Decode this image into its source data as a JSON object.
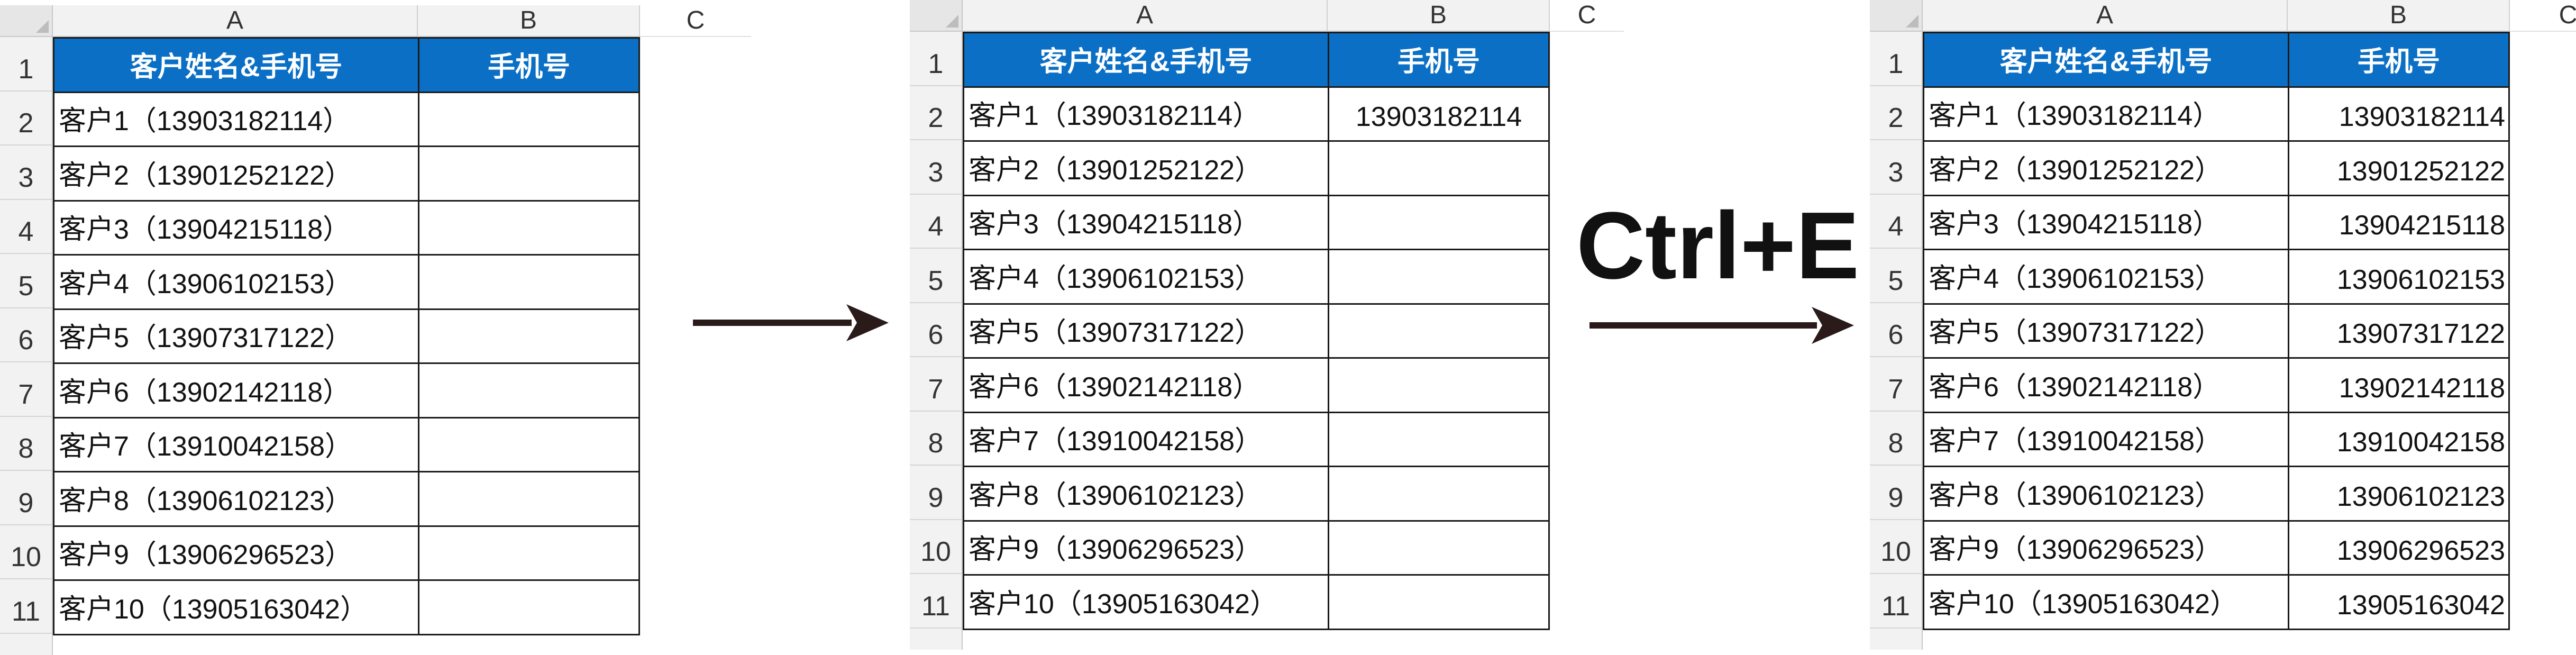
{
  "column_headers": [
    "A",
    "B",
    "C"
  ],
  "row_numbers": [
    "1",
    "2",
    "3",
    "4",
    "5",
    "6",
    "7",
    "8",
    "9",
    "10",
    "11"
  ],
  "header_row": {
    "col_a": "客户姓名&手机号",
    "col_b": "手机号"
  },
  "customers": [
    {
      "a": "客户1（13903182114）",
      "b": "13903182114"
    },
    {
      "a": "客户2（13901252122）",
      "b": "13901252122"
    },
    {
      "a": "客户3（13904215118）",
      "b": "13904215118"
    },
    {
      "a": "客户4（13906102153）",
      "b": "13906102153"
    },
    {
      "a": "客户5（13907317122）",
      "b": "13907317122"
    },
    {
      "a": "客户6（13902142118）",
      "b": "13902142118"
    },
    {
      "a": "客户7（13910042158）",
      "b": "13910042158"
    },
    {
      "a": "客户8（13906102123）",
      "b": "13906102123"
    },
    {
      "a": "客户9（13906296523）",
      "b": "13906296523"
    },
    {
      "a": "客户10（13905163042）",
      "b": "13905163042"
    }
  ],
  "shortcut_label": "Ctrl+E",
  "colors": {
    "header_fill": "#0b70c5",
    "header_text": "#ffffff",
    "arrow": "#2a1a1a"
  }
}
